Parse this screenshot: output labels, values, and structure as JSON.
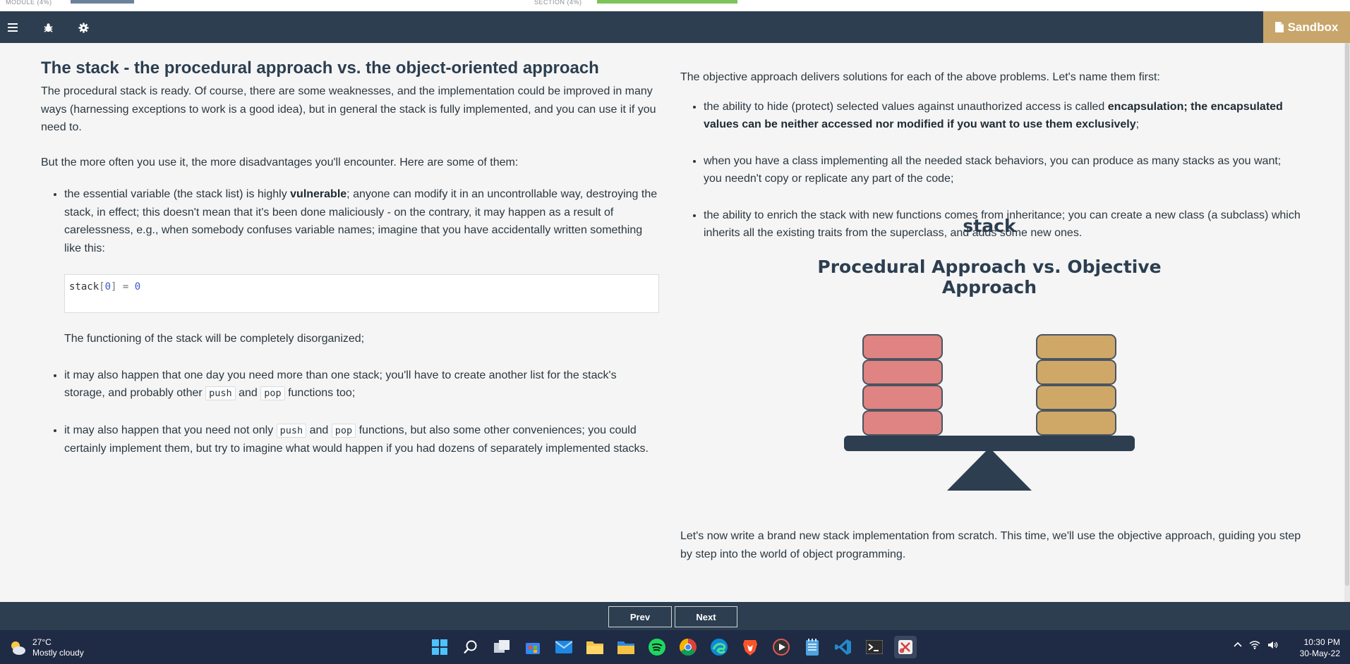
{
  "progress": {
    "module_label": "MODULE (4%)",
    "section_label": "SECTION (4%)"
  },
  "toolbar": {
    "sandbox_label": "Sandbox"
  },
  "left": {
    "title": "The stack - the procedural approach vs. the object-oriented approach",
    "intro": "The procedural stack is ready. Of course, there are some weaknesses, and the implementation could be improved in many ways (harnessing exceptions to work is a good idea), but in general the stack is fully implemented, and you can use it if you need to.",
    "disadvantages_intro": "But the more often you use it, the more disadvantages you'll encounter. Here are some of them:",
    "bullet1_pre": "the essential variable (the stack list) is highly ",
    "bullet1_bold": "vulnerable",
    "bullet1_post": "; anyone can modify it in an uncontrollable way, destroying the stack, in effect; this doesn't mean that it's been done maliciously - on the contrary, it may happen as a result of carelessness, e.g., when somebody confuses variable names; imagine that you have accidentally written something like this:",
    "code_var": "stack",
    "code_open": "[",
    "code_index": "0",
    "code_close": "]",
    "code_eq": " = ",
    "code_val": "0",
    "bullet1_after": "The functioning of the stack will be completely disorganized;",
    "bullet2_pre": "it may also happen that one day you need more than one stack; you'll have to create another list for the stack's storage, and probably other ",
    "bullet2_code1": "push",
    "bullet2_mid": " and ",
    "bullet2_code2": "pop",
    "bullet2_post": " functions too;",
    "bullet3_pre": "it may also happen that you need not only ",
    "bullet3_code1": "push",
    "bullet3_mid": " and ",
    "bullet3_code2": "pop",
    "bullet3_post": " functions, but also some other conveniences; you could certainly implement them, but try to imagine what would happen if you had dozens of separately implemented stacks."
  },
  "right": {
    "intro": "The objective approach delivers solutions for each of the above problems. Let's name them first:",
    "bullet1_pre": "the ability to hide (protect) selected values against unauthorized access is called ",
    "bullet1_bold": "encapsulation; the encapsulated values can be neither accessed nor modified if you want to use them exclusively",
    "bullet1_post": ";",
    "bullet2": "when you have a class implementing all the needed stack behaviors, you can produce as many stacks as you want; you needn't copy or replicate any part of the code;",
    "bullet3": "the ability to enrich the stack with new functions comes from inheritance; you can create a new class (a subclass) which inherits all the existing traits from the superclass, and adds some new ones.",
    "diagram_title": "stack",
    "diagram_subtitle": "Procedural Approach vs. Objective Approach",
    "outro": "Let's now write a brand new stack implementation from scratch. This time, we'll use the objective approach, guiding you step by step into the world of object programming."
  },
  "colors": {
    "procedural_block": "#df8383",
    "objective_block": "#cfa868",
    "block_border": "#4a5561",
    "seesaw": "#2c3e50"
  },
  "nav": {
    "prev_label": "Prev",
    "next_label": "Next"
  },
  "taskbar": {
    "temperature": "27°C",
    "weather": "Mostly cloudy",
    "time": "10:30 PM",
    "date": "30-May-22",
    "apps": [
      "start-icon",
      "search-icon",
      "task-view-icon",
      "store-icon",
      "mail-icon",
      "file-explorer-icon",
      "folder-icon",
      "spotify-icon",
      "chrome-icon",
      "edge-icon",
      "brave-icon",
      "media-player-icon",
      "notepad-icon",
      "vscode-icon",
      "terminal-icon",
      "snipping-tool-icon"
    ]
  }
}
